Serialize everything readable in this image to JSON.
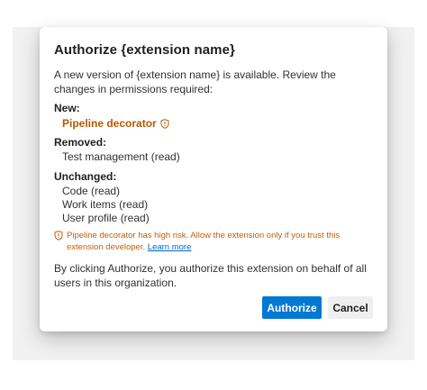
{
  "dialog": {
    "title": "Authorize {extension name}",
    "intro": "A new version of {extension name} is available. Review the changes in permissions required:",
    "sections": {
      "new": {
        "heading": "New:",
        "items": [
          "Pipeline decorator"
        ]
      },
      "removed": {
        "heading": "Removed:",
        "items": [
          "Test management (read)"
        ]
      },
      "unchanged": {
        "heading": "Unchanged:",
        "items": [
          "Code (read)",
          "Work items (read)",
          "User profile (read)"
        ]
      }
    },
    "warning": {
      "text": "Pipeline decorator has high risk. Allow the extension only if you trust this extension developer.",
      "link_label": "Learn more",
      "icon": "shield-icon",
      "color": "#c25e0a"
    },
    "consent": "By clicking Authorize, you authorize this extension on behalf of all users in this organization.",
    "buttons": {
      "authorize_label": "Authorize",
      "cancel_label": "Cancel"
    }
  },
  "colors": {
    "primary": "#0078d4",
    "risk": "#b35900",
    "link": "#0066cc"
  }
}
